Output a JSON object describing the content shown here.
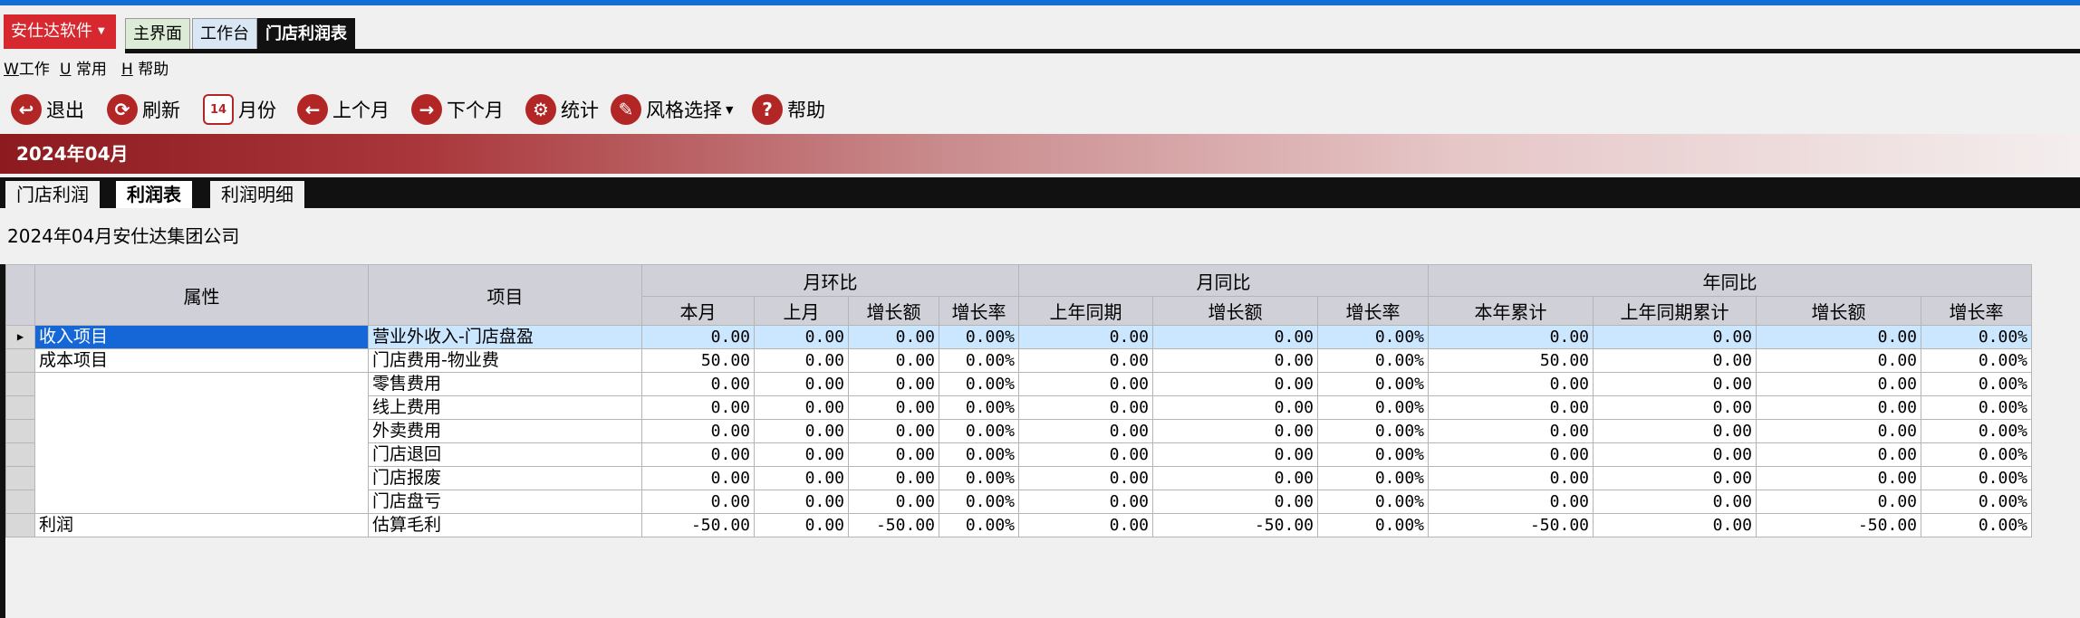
{
  "app": {
    "brand": "安仕达软件",
    "tabs": [
      {
        "label": "主界面"
      },
      {
        "label": "工作台"
      },
      {
        "label": "门店利润表"
      }
    ]
  },
  "menu": [
    {
      "key": "W",
      "label": "工作"
    },
    {
      "key": "U",
      "label": "常用"
    },
    {
      "key": "H",
      "label": "帮助"
    }
  ],
  "toolbar": {
    "exit": "退出",
    "refresh": "刷新",
    "month": "月份",
    "prev_month": "上个月",
    "next_month": "下个月",
    "stats": "统计",
    "style": "风格选择",
    "help": "帮助",
    "calendar_day": "14"
  },
  "banner": {
    "period": "2024年04月"
  },
  "subtabs": [
    {
      "label": "门店利润"
    },
    {
      "label": "利润表"
    },
    {
      "label": "利润明细"
    }
  ],
  "company": "2024年04月安仕达集团公司",
  "table": {
    "headers": {
      "attr": "属性",
      "item": "项目",
      "mom_group": "月环比",
      "yoy_group": "月同比",
      "year_group": "年同比",
      "cols": [
        "本月",
        "上月",
        "增长额",
        "增长率",
        "上年同期",
        "增长额",
        "增长率",
        "本年累计",
        "上年同期累计",
        "增长额",
        "增长率"
      ]
    },
    "rows": [
      {
        "attr": "收入项目",
        "item": "营业外收入-门店盘盈",
        "v": [
          "0.00",
          "0.00",
          "0.00",
          "0.00%",
          "0.00",
          "0.00",
          "0.00%",
          "0.00",
          "0.00",
          "0.00",
          "0.00%"
        ]
      },
      {
        "attr": "成本项目",
        "item": "门店费用-物业费",
        "v": [
          "50.00",
          "0.00",
          "0.00",
          "0.00%",
          "0.00",
          "0.00",
          "0.00%",
          "50.00",
          "0.00",
          "0.00",
          "0.00%"
        ]
      },
      {
        "attr": "",
        "item": "零售费用",
        "v": [
          "0.00",
          "0.00",
          "0.00",
          "0.00%",
          "0.00",
          "0.00",
          "0.00%",
          "0.00",
          "0.00",
          "0.00",
          "0.00%"
        ]
      },
      {
        "attr": "",
        "item": "线上费用",
        "v": [
          "0.00",
          "0.00",
          "0.00",
          "0.00%",
          "0.00",
          "0.00",
          "0.00%",
          "0.00",
          "0.00",
          "0.00",
          "0.00%"
        ]
      },
      {
        "attr": "",
        "item": "外卖费用",
        "v": [
          "0.00",
          "0.00",
          "0.00",
          "0.00%",
          "0.00",
          "0.00",
          "0.00%",
          "0.00",
          "0.00",
          "0.00",
          "0.00%"
        ]
      },
      {
        "attr": "",
        "item": "门店退回",
        "v": [
          "0.00",
          "0.00",
          "0.00",
          "0.00%",
          "0.00",
          "0.00",
          "0.00%",
          "0.00",
          "0.00",
          "0.00",
          "0.00%"
        ]
      },
      {
        "attr": "",
        "item": "门店报废",
        "v": [
          "0.00",
          "0.00",
          "0.00",
          "0.00%",
          "0.00",
          "0.00",
          "0.00%",
          "0.00",
          "0.00",
          "0.00",
          "0.00%"
        ]
      },
      {
        "attr": "",
        "item": "门店盘亏",
        "v": [
          "0.00",
          "0.00",
          "0.00",
          "0.00%",
          "0.00",
          "0.00",
          "0.00%",
          "0.00",
          "0.00",
          "0.00",
          "0.00%"
        ]
      },
      {
        "attr": "利润",
        "item": "估算毛利",
        "v": [
          "-50.00",
          "0.00",
          "-50.00",
          "0.00%",
          "0.00",
          "-50.00",
          "0.00%",
          "-50.00",
          "0.00",
          "-50.00",
          "0.00%"
        ]
      }
    ]
  }
}
